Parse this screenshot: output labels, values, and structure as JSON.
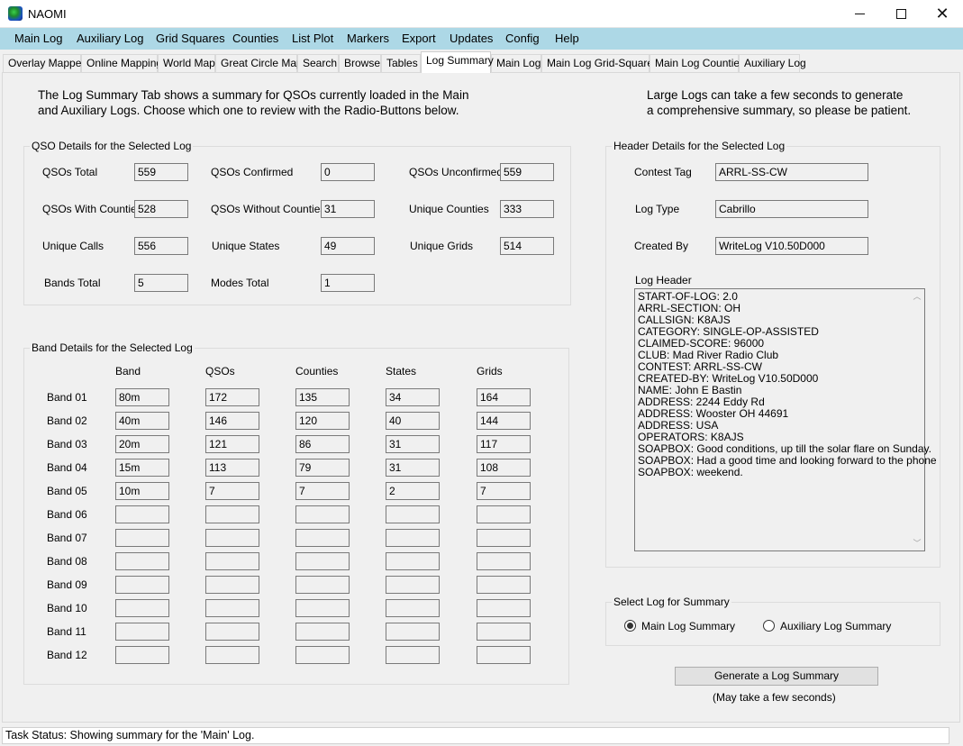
{
  "window": {
    "title": "NAOMI"
  },
  "menu": [
    "Main Log",
    "Auxiliary Log",
    "Grid Squares",
    "Counties",
    "List Plot",
    "Markers",
    "Export",
    "Updates",
    "Config",
    "Help"
  ],
  "tabs": [
    "Overlay Mapper",
    "Online Mapping",
    "World Map",
    "Great Circle Map",
    "Search",
    "Browse",
    "Tables",
    "Log Summary",
    "Main Log",
    "Main Log Grid-Squares",
    "Main Log Counties",
    "Auxiliary Log"
  ],
  "active_tab": "Log Summary",
  "intro_left": [
    "The Log Summary Tab shows a summary for QSOs currently loaded in the Main",
    "and Auxiliary Logs. Choose which one to review with the Radio-Buttons below."
  ],
  "intro_right": [
    "Large Logs can take a few seconds to generate",
    "a comprehensive summary, so please be patient."
  ],
  "qso_details": {
    "title": "QSO Details for the Selected Log",
    "fields": [
      {
        "label": "QSOs Total",
        "value": "559"
      },
      {
        "label": "QSOs Confirmed",
        "value": "0"
      },
      {
        "label": "QSOs Unconfirmed",
        "value": "559"
      },
      {
        "label": "QSOs With Counties",
        "value": "528"
      },
      {
        "label": "QSOs Without Counties",
        "value": "31"
      },
      {
        "label": "Unique Counties",
        "value": "333"
      },
      {
        "label": "Unique Calls",
        "value": "556"
      },
      {
        "label": "Unique States",
        "value": "49"
      },
      {
        "label": "Unique Grids",
        "value": "514"
      },
      {
        "label": "Bands Total",
        "value": "5"
      },
      {
        "label": "Modes Total",
        "value": "1"
      }
    ]
  },
  "band_details": {
    "title": "Band Details for the Selected Log",
    "columns": [
      "Band",
      "QSOs",
      "Counties",
      "States",
      "Grids"
    ],
    "rows": [
      {
        "label": "Band 01",
        "cells": [
          "80m",
          "172",
          "135",
          "34",
          "164"
        ]
      },
      {
        "label": "Band 02",
        "cells": [
          "40m",
          "146",
          "120",
          "40",
          "144"
        ]
      },
      {
        "label": "Band 03",
        "cells": [
          "20m",
          "121",
          "86",
          "31",
          "117"
        ]
      },
      {
        "label": "Band 04",
        "cells": [
          "15m",
          "113",
          "79",
          "31",
          "108"
        ]
      },
      {
        "label": "Band 05",
        "cells": [
          "10m",
          "7",
          "7",
          "2",
          "7"
        ]
      },
      {
        "label": "Band 06",
        "cells": [
          "",
          "",
          "",
          "",
          ""
        ]
      },
      {
        "label": "Band 07",
        "cells": [
          "",
          "",
          "",
          "",
          ""
        ]
      },
      {
        "label": "Band 08",
        "cells": [
          "",
          "",
          "",
          "",
          ""
        ]
      },
      {
        "label": "Band 09",
        "cells": [
          "",
          "",
          "",
          "",
          ""
        ]
      },
      {
        "label": "Band 10",
        "cells": [
          "",
          "",
          "",
          "",
          ""
        ]
      },
      {
        "label": "Band 11",
        "cells": [
          "",
          "",
          "",
          "",
          ""
        ]
      },
      {
        "label": "Band 12",
        "cells": [
          "",
          "",
          "",
          "",
          ""
        ]
      }
    ]
  },
  "header_details": {
    "title": "Header Details for the Selected Log",
    "contest_tag_label": "Contest Tag",
    "contest_tag": "ARRL-SS-CW",
    "log_type_label": "Log Type",
    "log_type": "Cabrillo",
    "created_by_label": "Created By",
    "created_by": "WriteLog V10.50D000",
    "log_header_label": "Log Header",
    "log_header_lines": [
      "START-OF-LOG: 2.0",
      "ARRL-SECTION: OH",
      "CALLSIGN: K8AJS",
      "CATEGORY: SINGLE-OP-ASSISTED",
      "CLAIMED-SCORE: 96000",
      "CLUB: Mad River Radio Club",
      "CONTEST: ARRL-SS-CW",
      "CREATED-BY: WriteLog V10.50D000",
      "NAME: John E Bastin",
      "ADDRESS: 2244 Eddy Rd",
      "ADDRESS: Wooster OH 44691",
      "ADDRESS: USA",
      "OPERATORS: K8AJS",
      "SOAPBOX: Good conditions, up till the solar flare on Sunday.",
      "SOAPBOX: Had a good time and looking forward to the phone",
      "SOAPBOX: weekend."
    ]
  },
  "select_log": {
    "title": "Select Log for Summary",
    "main_label": "Main Log Summary",
    "aux_label": "Auxiliary Log Summary",
    "selected": "main"
  },
  "generate": {
    "button_label": "Generate a Log Summary",
    "note": "(May take a few seconds)"
  },
  "status": "Task Status: Showing summary for the 'Main' Log.",
  "icons": {
    "app": "naomi-globe-icon",
    "minimize": "minimize-icon",
    "maximize": "maximize-icon",
    "close": "close-icon"
  }
}
